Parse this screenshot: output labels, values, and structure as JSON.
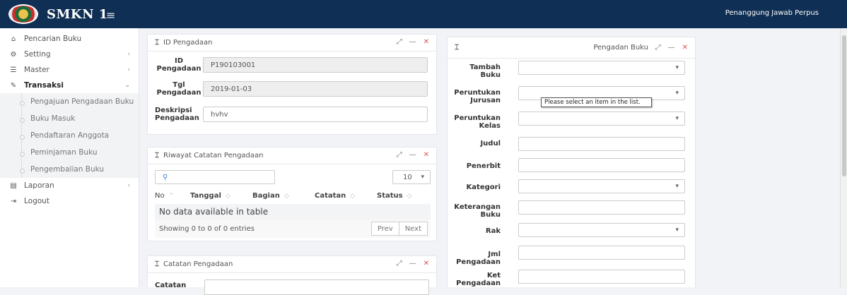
{
  "app": {
    "title": "SMKN 1",
    "user": "Penanggung Jawab Perpus",
    "hamburger_icon": "≡"
  },
  "sidebar": {
    "items": [
      {
        "label": "Pencarian Buku",
        "icon": "home-icon"
      },
      {
        "label": "Setting",
        "icon": "gear-icon"
      },
      {
        "label": "Master",
        "icon": "database-icon"
      },
      {
        "label": "Transaksi",
        "icon": "edit-icon"
      },
      {
        "label": "Laporan",
        "icon": "report-icon"
      },
      {
        "label": "Logout",
        "icon": "logout-icon"
      }
    ],
    "sub_items": [
      "Pengajuan Pengadaan Buku",
      "Buku Masuk",
      "Pendaftaran Anggota",
      "Peminjaman Buku",
      "Pengembalian Buku"
    ]
  },
  "panel_id": {
    "title": "ID Pengadaan",
    "fields": [
      {
        "label": "ID Pengadaan",
        "label_l1": "ID",
        "label_l2": "Pengadaan",
        "value": "P190103001"
      },
      {
        "label": "Tgl Pengadaan",
        "label_l1": "Tgl",
        "label_l2": "Pengadaan",
        "value": "2019-01-03"
      },
      {
        "label": "Deskripsi Pengadaan",
        "label_l1": "Deskripsi",
        "label_l2": "Pengadaan",
        "value": "hvhv"
      }
    ]
  },
  "panel_riwayat": {
    "title": "Riwayat Catatan Pengadaan",
    "page_size": "10",
    "columns": [
      "No",
      "Tanggal",
      "Bagian",
      "Catatan",
      "Status"
    ],
    "empty": "No data available in table",
    "info": "Showing 0 to 0 of 0 entries",
    "prev": "Prev",
    "next": "Next"
  },
  "panel_catatan": {
    "title": "Catatan Pengadaan",
    "field_label": "Catatan"
  },
  "panel_buku": {
    "title": "Pengadan Buku",
    "fields": [
      {
        "l1": "Tambah",
        "l2": "Buku",
        "type": "select"
      },
      {
        "l1": "Peruntukan",
        "l2": "Jurusan",
        "type": "select"
      },
      {
        "l1": "Peruntukan",
        "l2": "Kelas",
        "type": "select"
      },
      {
        "l1": "Judul",
        "l2": "",
        "type": "text"
      },
      {
        "l1": "Penerbit",
        "l2": "",
        "type": "text"
      },
      {
        "l1": "Kategori",
        "l2": "",
        "type": "select"
      },
      {
        "l1": "Keterangan",
        "l2": "Buku",
        "type": "text"
      },
      {
        "l1": "Rak",
        "l2": "",
        "type": "select"
      },
      {
        "l1": "Jml",
        "l2": "Pengadaan",
        "type": "text"
      },
      {
        "l1": "Ket",
        "l2": "Pengadaan",
        "type": "text"
      }
    ],
    "tooltip": "Please select an item in the list."
  }
}
